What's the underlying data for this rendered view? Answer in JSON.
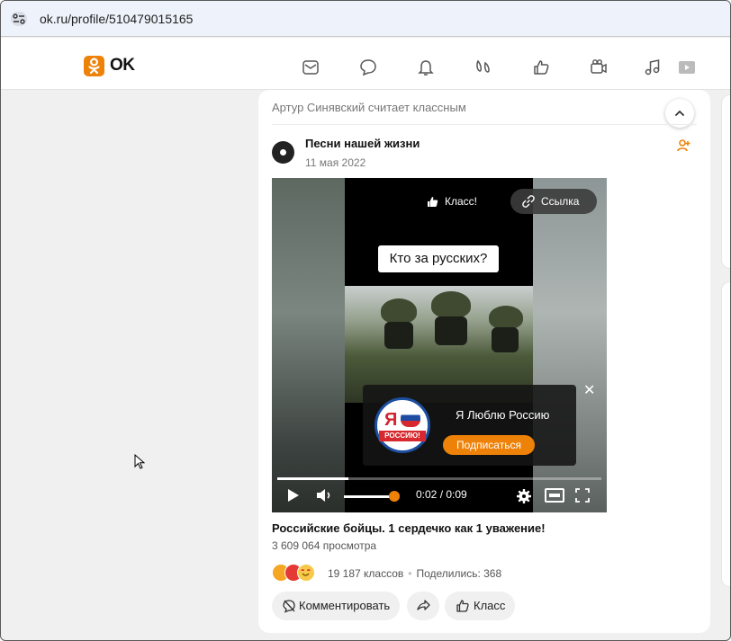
{
  "browser": {
    "url": "ok.ru/profile/510479015165"
  },
  "header": {
    "logo_text": "OK",
    "accent": "#ee8208"
  },
  "nav_icons": [
    "messages-icon",
    "discussions-icon",
    "notifications-icon",
    "guests-icon",
    "marks-icon",
    "video-icon",
    "music-icon"
  ],
  "post": {
    "liked_by": "Артур Синявский считает классным",
    "group_name": "Песни нашей жизни",
    "date": "11 мая 2022",
    "video": {
      "klass_label": "Класс!",
      "link_label": "Ссылка",
      "caption": "Кто за русских?",
      "promo_title": "Я Люблю Россию",
      "promo_badge_big": "Я",
      "promo_badge_ribbon": "РОССИЮ!",
      "subscribe_label": "Подписаться",
      "time": "0:02 / 0:09",
      "progress": 0.22,
      "volume": 0.88
    },
    "title": "Российские бойцы. 1 сердечко как 1 уважение!",
    "views": "3 609 064 просмотра",
    "klass_count": "19 187 классов",
    "shares": "Поделились: 368",
    "comment_button": "Комментировать",
    "klass_button": "Класс"
  }
}
